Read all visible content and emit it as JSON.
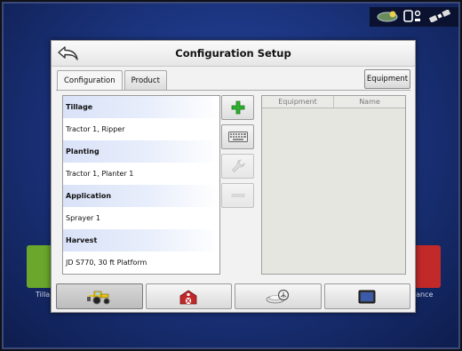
{
  "dialog": {
    "title": "Configuration Setup",
    "back_icon": "back-arrow-icon"
  },
  "tabs": [
    {
      "label": "Configuration",
      "active": true
    },
    {
      "label": "Product",
      "active": false
    }
  ],
  "equipment_button": {
    "label": "Equipment"
  },
  "config_list": {
    "groups": [
      {
        "header": "Tillage",
        "item": "Tractor 1, Ripper"
      },
      {
        "header": "Planting",
        "item": "Tractor 1, Planter 1"
      },
      {
        "header": "Application",
        "item": "Sprayer 1"
      },
      {
        "header": "Harvest",
        "item": "JD S770, 30 ft Platform"
      }
    ]
  },
  "actions": [
    {
      "icon": "add-plus-icon",
      "enabled": true
    },
    {
      "icon": "keyboard-icon",
      "enabled": true
    },
    {
      "icon": "wrench-icon",
      "enabled": false
    },
    {
      "icon": "minus-icon",
      "enabled": false
    }
  ],
  "equipment_table": {
    "columns": [
      "Equipment",
      "Name"
    ],
    "rows": []
  },
  "bottom_nav": [
    {
      "icon": "tractor-icon",
      "active": true
    },
    {
      "icon": "barn-icon",
      "active": false
    },
    {
      "icon": "gps-receiver-icon",
      "active": false
    },
    {
      "icon": "display-icon",
      "active": false
    }
  ],
  "background": {
    "left_tile_label": "Tilla",
    "right_tile_label": "dance"
  },
  "colors": {
    "background_blue": "#1c3580",
    "group_header_blue": "#d9e2f8",
    "add_green": "#2fae2f",
    "barn_red": "#c0282a"
  }
}
